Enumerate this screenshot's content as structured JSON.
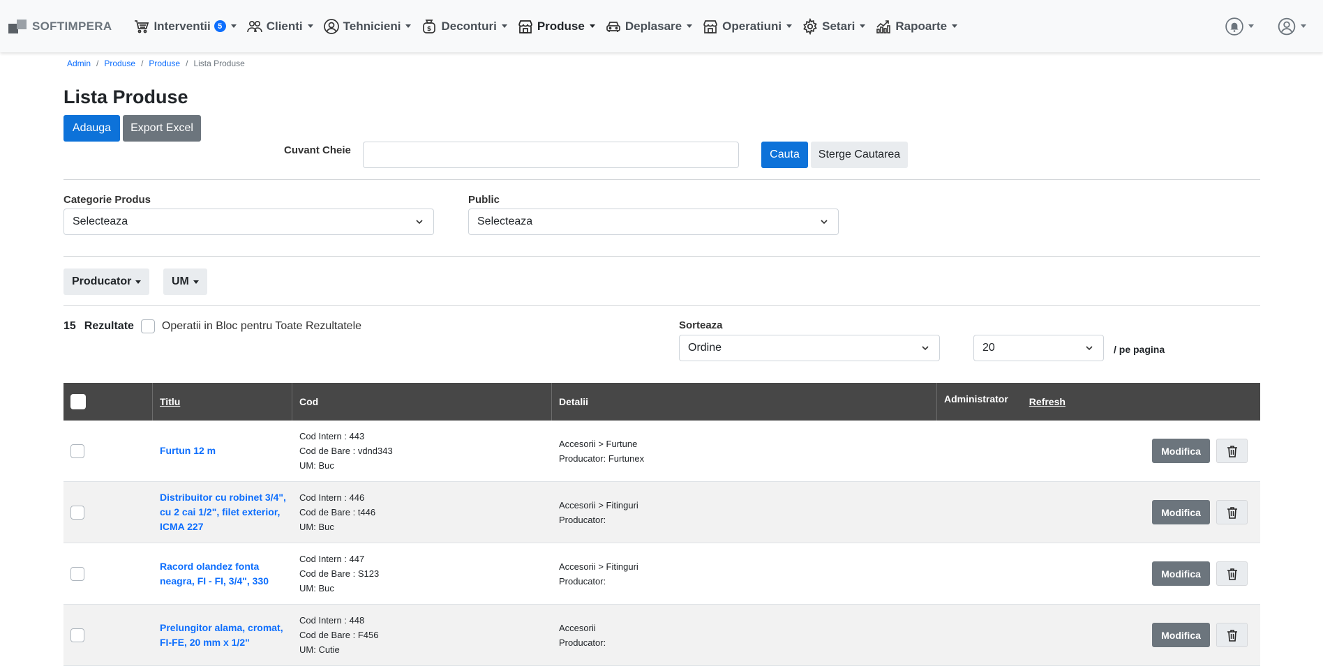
{
  "nav": {
    "brand": "SOFTIMPERA",
    "items": [
      {
        "label": "Interventii",
        "icon": "cart-icon",
        "badge": "5"
      },
      {
        "label": "Clienti",
        "icon": "users-icon"
      },
      {
        "label": "Tehnicieni",
        "icon": "user-circle-icon"
      },
      {
        "label": "Deconturi",
        "icon": "money-bag-icon"
      },
      {
        "label": "Produse",
        "icon": "store-icon"
      },
      {
        "label": "Deplasare",
        "icon": "car-icon"
      },
      {
        "label": "Operatiuni",
        "icon": "store-icon"
      },
      {
        "label": "Setari",
        "icon": "gear-icon"
      },
      {
        "label": "Rapoarte",
        "icon": "chart-icon"
      }
    ]
  },
  "breadcrumb": [
    "Admin",
    "Produse",
    "Produse",
    "Lista Produse"
  ],
  "page": {
    "title": "Lista Produse",
    "add_label": "Adauga",
    "export_label": "Export Excel"
  },
  "search": {
    "label": "Cuvant Cheie",
    "value": "",
    "search_label": "Cauta",
    "clear_label": "Sterge Cautarea"
  },
  "filters": {
    "category_label": "Categorie Produs",
    "category_value": "Selecteaza",
    "public_label": "Public",
    "public_value": "Selecteaza",
    "producer_label": "Producator",
    "um_label": "UM"
  },
  "results": {
    "count": "15",
    "label": "Rezultate",
    "bulk_label": "Operatii in Bloc pentru Toate Rezultatele",
    "sort_label": "Sorteaza",
    "sort_value": "Ordine",
    "per_page_value": "20",
    "per_page_label": "/  pe pagina"
  },
  "table": {
    "headers": {
      "title": "Titlu",
      "code": "Cod",
      "details": "Detalii",
      "admin": "Administrator",
      "refresh": "Refresh"
    },
    "modify_label": "Modifica",
    "rows": [
      {
        "title": "Furtun 12 m",
        "cod_intern": "Cod Intern : 443",
        "cod_bare": "Cod de Bare : vdnd343",
        "um": "UM: Buc",
        "category": "Accesorii > Furtune",
        "producer": "Producator: Furtunex"
      },
      {
        "title": "Distribuitor cu robinet 3/4\", cu 2 cai 1/2\", filet exterior, ICMA 227",
        "cod_intern": "Cod Intern : 446",
        "cod_bare": "Cod de Bare : t446",
        "um": "UM: Buc",
        "category": "Accesorii > Fitinguri",
        "producer": "Producator:"
      },
      {
        "title": "Racord olandez fonta neagra, FI - FI, 3/4\", 330",
        "cod_intern": "Cod Intern : 447",
        "cod_bare": "Cod de Bare : S123",
        "um": "UM: Buc",
        "category": "Accesorii > Fitinguri",
        "producer": "Producator:"
      },
      {
        "title": "Prelungitor alama, cromat, FI-FE, 20 mm x 1/2\"",
        "cod_intern": "Cod Intern : 448",
        "cod_bare": "Cod de Bare : F456",
        "um": "UM: Cutie",
        "category": "Accesorii",
        "producer": "Producator:"
      }
    ]
  }
}
